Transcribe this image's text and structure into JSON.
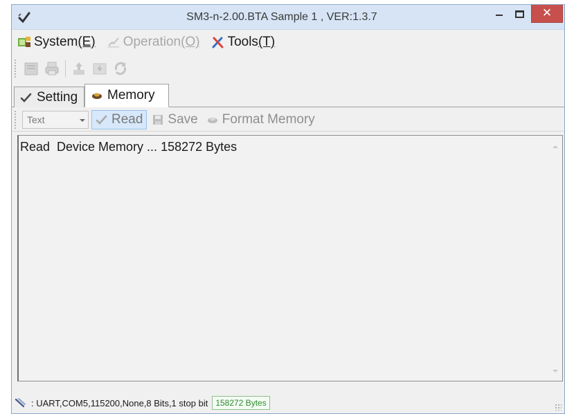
{
  "window": {
    "title": "SM3-n-2.00.BTA Sample 1 , VER:1.3.7",
    "close_glyph": "✕"
  },
  "menu": {
    "system": {
      "text": "System ",
      "key": "(E)"
    },
    "operation": {
      "text": "Operation ",
      "key": "(O)"
    },
    "tools": {
      "text": "Tools ",
      "key": "(T)"
    }
  },
  "toolbar": {
    "icons": [
      "device-icon",
      "printer-icon",
      "upload-icon",
      "download-icon",
      "refresh-icon"
    ]
  },
  "tabs": [
    {
      "label": "Setting",
      "icon": "checkmark-icon"
    },
    {
      "label": "Memory",
      "icon": "memory-chip-icon",
      "selected": true
    }
  ],
  "memory_toolbar": {
    "format_select": "Text",
    "read_label": "Read",
    "save_label": "Save",
    "format_memory_label": "Format Memory"
  },
  "output": {
    "text": "Read  Device Memory ... 158272 Bytes"
  },
  "status": {
    "connection": ": UART,COM5,115200,None,8 Bits,1 stop bit",
    "bytes": "158272 Bytes"
  },
  "colors": {
    "titlebar": "#d6e4f5",
    "close_button": "#c7504c",
    "active_button": "#d7e8fa",
    "status_bytes": "#2f8a2f"
  }
}
